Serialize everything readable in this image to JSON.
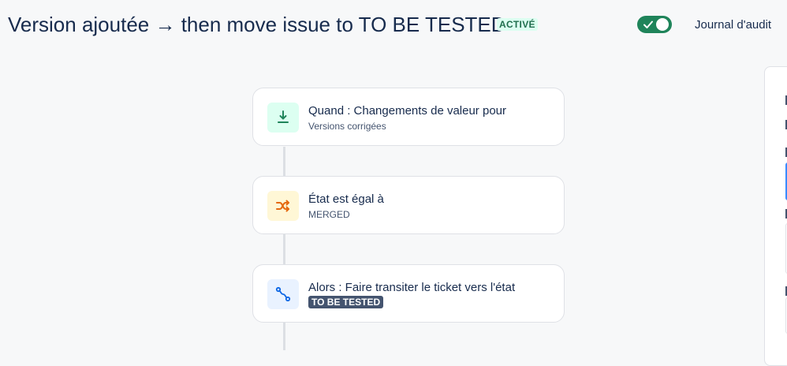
{
  "header": {
    "title": "Version ajoutée → then move issue to TO BE TESTED",
    "status": "ACTIVÉ",
    "toggle_on": true,
    "audit_label": "Journal d'audit"
  },
  "flow": {
    "trigger": {
      "title": "Quand : Changements de valeur pour",
      "subtitle": "Versions corrigées",
      "icon": "download-arrow-icon"
    },
    "condition": {
      "title": "État est égal à",
      "subtitle": "MERGED",
      "icon": "shuffle-icon"
    },
    "action": {
      "title": "Alors : Faire transiter le ticket vers l'état",
      "status_lozenge": "TO BE TESTED",
      "icon": "transition-path-icon"
    }
  },
  "colors": {
    "title_text": "#172b4d",
    "toggle_on": "#1f845a",
    "active_badge_bg": "#dcfff1",
    "active_badge_text": "#216e4e",
    "trigger_icon_bg": "#dcfff1",
    "trigger_icon_fg": "#1f845a",
    "condition_icon_bg": "#fff7d6",
    "condition_icon_fg": "#e56910",
    "action_icon_bg": "#e9f2ff",
    "action_icon_fg": "#0c66e4",
    "lozenge_bg": "#44546f"
  }
}
